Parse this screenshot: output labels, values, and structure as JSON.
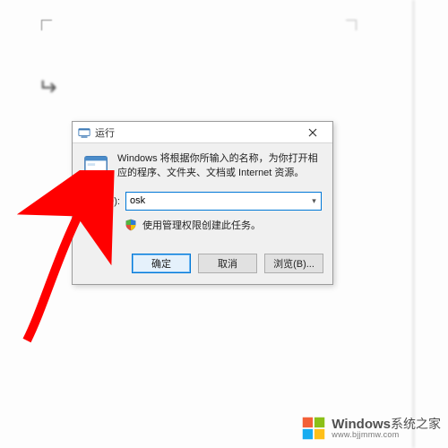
{
  "dialog": {
    "title": "运行",
    "description": "Windows 将根据你所输入的名称，为你打开相应的程序、文件夹、文档或 Internet 资源。",
    "open_label": "打开(O):",
    "input_value": "osk",
    "admin_text": "使用管理权限创建此任务。",
    "ok": "确定",
    "cancel": "取消",
    "browse": "浏览(B)..."
  },
  "watermark": {
    "brand": "Windows",
    "line2": "系统之家",
    "url": "www.bjjmmw.com"
  }
}
